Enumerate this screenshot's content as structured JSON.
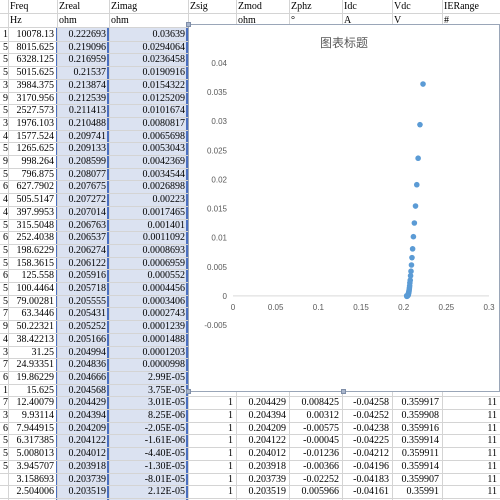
{
  "headers": {
    "row1": [
      "Freq",
      "Zreal",
      "Zimag",
      "Zsig",
      "Zmod",
      "Zphz",
      "Idc",
      "Vdc",
      "IERange"
    ],
    "row2": [
      "Hz",
      "ohm",
      "ohm",
      "",
      "ohm",
      "°",
      "A",
      "V",
      "#"
    ]
  },
  "row_stubs": [
    "1",
    "5",
    "5",
    "5",
    "3",
    "9",
    "5",
    "3",
    "4",
    "5",
    "9",
    "5",
    "6",
    "4",
    "4",
    "5",
    "6",
    "5",
    "5",
    "6",
    "5",
    "5",
    "7",
    "9",
    "4",
    "3",
    "7",
    "6",
    "1",
    "7",
    "3",
    "6",
    "5",
    "5",
    "5"
  ],
  "left_rows": [
    [
      "10078.13",
      "0.222693",
      "0.03639"
    ],
    [
      "8015.625",
      "0.219096",
      "0.0294064"
    ],
    [
      "6328.125",
      "0.216959",
      "0.0236458"
    ],
    [
      "5015.625",
      "0.21537",
      "0.0190916"
    ],
    [
      "3984.375",
      "0.213874",
      "0.0154322"
    ],
    [
      "3170.956",
      "0.212539",
      "0.0125209"
    ],
    [
      "2527.573",
      "0.211413",
      "0.0101674"
    ],
    [
      "1976.103",
      "0.210488",
      "0.0080817"
    ],
    [
      "1577.524",
      "0.209741",
      "0.0065698"
    ],
    [
      "1265.625",
      "0.209133",
      "0.0053043"
    ],
    [
      "998.264",
      "0.208599",
      "0.0042369"
    ],
    [
      "796.875",
      "0.208077",
      "0.0034544"
    ],
    [
      "627.7902",
      "0.207675",
      "0.0026898"
    ],
    [
      "505.5147",
      "0.207272",
      "0.00223"
    ],
    [
      "397.9953",
      "0.207014",
      "0.0017465"
    ],
    [
      "315.5048",
      "0.206763",
      "0.001401"
    ],
    [
      "252.4038",
      "0.206537",
      "0.0011092"
    ],
    [
      "198.6229",
      "0.206274",
      "0.0008693"
    ],
    [
      "158.3615",
      "0.206122",
      "0.0006959"
    ],
    [
      "125.558",
      "0.205916",
      "0.000552"
    ],
    [
      "100.4464",
      "0.205718",
      "0.0004456"
    ],
    [
      "79.00281",
      "0.205555",
      "0.0003406"
    ],
    [
      "63.3446",
      "0.205431",
      "0.0002743"
    ],
    [
      "50.22321",
      "0.205252",
      "0.0001239"
    ],
    [
      "38.42213",
      "0.205166",
      "0.0001488"
    ],
    [
      "31.25",
      "0.204994",
      "0.0001203"
    ],
    [
      "24.93351",
      "0.204836",
      "0.0000998"
    ],
    [
      "19.86229",
      "0.204666",
      "2.99E-05"
    ],
    [
      "15.625",
      "0.204568",
      "3.75E-05"
    ],
    [
      "12.40079",
      "0.204429",
      "3.01E-05"
    ],
    [
      "9.93114",
      "0.204394",
      "8.25E-06"
    ],
    [
      "7.944915",
      "0.204209",
      "-2.05E-05"
    ],
    [
      "6.317385",
      "0.204122",
      "-1.61E-06"
    ],
    [
      "5.008013",
      "0.204012",
      "-4.40E-05"
    ],
    [
      "3.945707",
      "0.203918",
      "-1.30E-05"
    ],
    [
      "3.158693",
      "0.203739",
      "-8.01E-05"
    ],
    [
      "2.504006",
      "0.203519",
      "2.12E-05"
    ]
  ],
  "bottom_rows": [
    [
      "1",
      "0.204429",
      "0.008425",
      "-0.04258",
      "0.359917",
      "11"
    ],
    [
      "1",
      "0.204394",
      "0.00312",
      "-0.04252",
      "0.359908",
      "11"
    ],
    [
      "1",
      "0.204209",
      "-0.00575",
      "-0.04238",
      "0.359916",
      "11"
    ],
    [
      "1",
      "0.204122",
      "-0.00045",
      "-0.04225",
      "0.359914",
      "11"
    ],
    [
      "1",
      "0.204012",
      "-0.01236",
      "-0.04212",
      "0.359911",
      "11"
    ],
    [
      "1",
      "0.203918",
      "-0.00366",
      "-0.04196",
      "0.359914",
      "11"
    ],
    [
      "1",
      "0.203739",
      "-0.02252",
      "-0.04183",
      "0.359907",
      "11"
    ],
    [
      "1",
      "0.203519",
      "0.005966",
      "-0.04161",
      "0.35991",
      "11"
    ]
  ],
  "chart_data": {
    "type": "scatter",
    "title": "图表标题",
    "xlim": [
      0,
      0.3
    ],
    "ylim": [
      -0.005,
      0.04
    ],
    "x_ticks": [
      "0",
      "0.05",
      "0.1",
      "0.15",
      "0.2",
      "0.25",
      "0.3"
    ],
    "y_ticks": [
      "0.04",
      "0.035",
      "0.03",
      "0.025",
      "0.02",
      "0.015",
      "0.01",
      "0.005",
      "0",
      "-0.005"
    ],
    "grid": false,
    "marker_color": "#5b9bd5",
    "x": [
      0.222693,
      0.219096,
      0.216959,
      0.21537,
      0.213874,
      0.212539,
      0.211413,
      0.210488,
      0.209741,
      0.209133,
      0.208599,
      0.208077,
      0.207675,
      0.207272,
      0.207014,
      0.206763,
      0.206537,
      0.206274,
      0.206122,
      0.205916,
      0.205718,
      0.205555,
      0.205431,
      0.205252,
      0.205166,
      0.204994,
      0.204836,
      0.204666,
      0.204568,
      0.204429,
      0.204394,
      0.204209,
      0.204122,
      0.204012,
      0.203918,
      0.203739,
      0.203519
    ],
    "y": [
      0.03639,
      0.0294064,
      0.0236458,
      0.0190916,
      0.0154322,
      0.0125209,
      0.0101674,
      0.0080817,
      0.0065698,
      0.0053043,
      0.0042369,
      0.0034544,
      0.0026898,
      0.00223,
      0.0017465,
      0.001401,
      0.0011092,
      0.0008693,
      0.0006959,
      0.000552,
      0.0004456,
      0.0003406,
      0.0002743,
      0.0001239,
      0.0001488,
      0.0001203,
      9.98e-05,
      2.99e-05,
      3.75e-05,
      3.01e-05,
      8.25e-06,
      -2.05e-05,
      -1.61e-06,
      -4.4e-05,
      -1.3e-05,
      -8.01e-05,
      2.12e-05
    ]
  }
}
